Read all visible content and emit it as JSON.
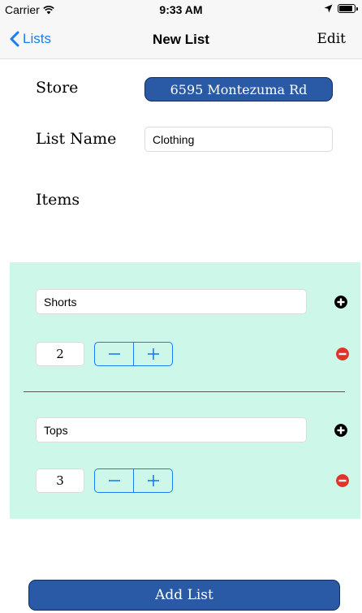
{
  "status_bar": {
    "carrier": "Carrier",
    "time": "9:33 AM",
    "battery_icon": "battery-icon",
    "wifi_icon": "wifi-icon",
    "location_icon": "location-arrow-icon"
  },
  "nav": {
    "back_label": "Lists",
    "back_icon": "chevron-left-icon",
    "title": "New List",
    "edit_label": "Edit"
  },
  "form": {
    "store_label": "Store",
    "store_value": "6595 Montezuma Rd",
    "list_name_label": "List Name",
    "list_name_value": "Clothing",
    "items_label": "Items"
  },
  "items": [
    {
      "name": "Shorts",
      "quantity": "2"
    },
    {
      "name": "Tops",
      "quantity": "3"
    }
  ],
  "stepper": {
    "minus_label": "−",
    "plus_label": "+"
  },
  "footer": {
    "add_list_label": "Add List"
  },
  "colors": {
    "accent_blue": "#1e7cf2",
    "button_blue": "#2a5aa6",
    "panel_green": "#cdf7e8",
    "remove_red": "#e0342a"
  }
}
